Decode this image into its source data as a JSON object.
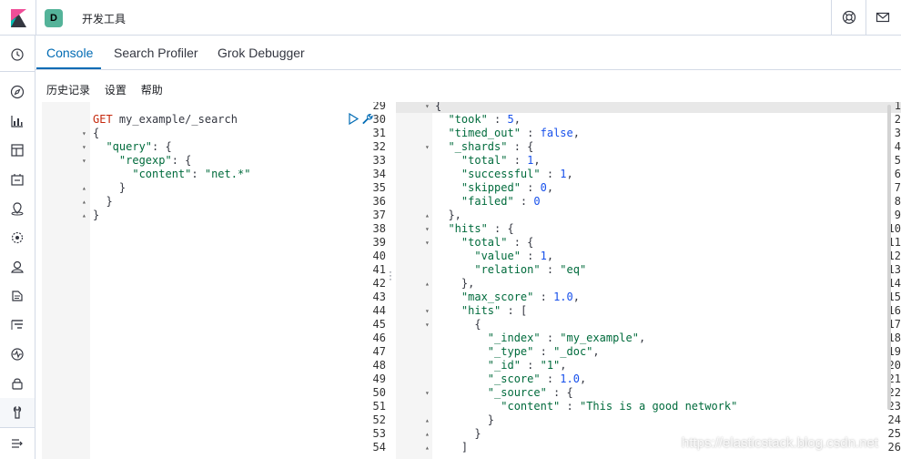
{
  "header": {
    "space_initial": "D",
    "app_title": "开发工具",
    "help_icon": "help-icon",
    "mail_icon": "newsfeed-icon"
  },
  "tabs": [
    {
      "label": "Console",
      "active": true
    },
    {
      "label": "Search Profiler",
      "active": false
    },
    {
      "label": "Grok Debugger",
      "active": false
    }
  ],
  "submenu": {
    "history": "历史记录",
    "settings": "设置",
    "help": "帮助"
  },
  "request_editor": {
    "lines": [
      {
        "n": "29",
        "fold": "",
        "code": ""
      },
      {
        "n": "30",
        "fold": "",
        "code": "GET my_example/_search"
      },
      {
        "n": "31",
        "fold": "▾",
        "code": "{"
      },
      {
        "n": "32",
        "fold": "▾",
        "code": "  \"query\": {"
      },
      {
        "n": "33",
        "fold": "▾",
        "code": "    \"regexp\": {"
      },
      {
        "n": "34",
        "fold": "",
        "code": "      \"content\": \"net.*\""
      },
      {
        "n": "35",
        "fold": "▴",
        "code": "    }"
      },
      {
        "n": "36",
        "fold": "▴",
        "code": "  }"
      },
      {
        "n": "37",
        "fold": "▴",
        "code": "}"
      },
      {
        "n": "38",
        "fold": "",
        "code": ""
      },
      {
        "n": "39",
        "fold": "",
        "code": ""
      },
      {
        "n": "40",
        "fold": "",
        "code": ""
      },
      {
        "n": "41",
        "fold": "",
        "code": ""
      },
      {
        "n": "42",
        "fold": "",
        "code": ""
      },
      {
        "n": "43",
        "fold": "",
        "code": ""
      },
      {
        "n": "44",
        "fold": "",
        "code": ""
      },
      {
        "n": "45",
        "fold": "",
        "code": ""
      },
      {
        "n": "46",
        "fold": "",
        "code": ""
      },
      {
        "n": "47",
        "fold": "",
        "code": ""
      },
      {
        "n": "48",
        "fold": "",
        "code": ""
      },
      {
        "n": "49",
        "fold": "",
        "code": ""
      },
      {
        "n": "50",
        "fold": "",
        "code": ""
      },
      {
        "n": "51",
        "fold": "",
        "code": ""
      },
      {
        "n": "52",
        "fold": "",
        "code": ""
      },
      {
        "n": "53",
        "fold": "",
        "code": ""
      },
      {
        "n": "54",
        "fold": "",
        "code": ""
      }
    ],
    "method": "GET",
    "path": "my_example/_search"
  },
  "response_editor": {
    "lines": [
      {
        "n": "1",
        "fold": "▾",
        "code": "{"
      },
      {
        "n": "2",
        "fold": "",
        "code": "  \"took\" : 5,"
      },
      {
        "n": "3",
        "fold": "",
        "code": "  \"timed_out\" : false,"
      },
      {
        "n": "4",
        "fold": "▾",
        "code": "  \"_shards\" : {"
      },
      {
        "n": "5",
        "fold": "",
        "code": "    \"total\" : 1,"
      },
      {
        "n": "6",
        "fold": "",
        "code": "    \"successful\" : 1,"
      },
      {
        "n": "7",
        "fold": "",
        "code": "    \"skipped\" : 0,"
      },
      {
        "n": "8",
        "fold": "",
        "code": "    \"failed\" : 0"
      },
      {
        "n": "9",
        "fold": "▴",
        "code": "  },"
      },
      {
        "n": "10",
        "fold": "▾",
        "code": "  \"hits\" : {"
      },
      {
        "n": "11",
        "fold": "▾",
        "code": "    \"total\" : {"
      },
      {
        "n": "12",
        "fold": "",
        "code": "      \"value\" : 1,"
      },
      {
        "n": "13",
        "fold": "",
        "code": "      \"relation\" : \"eq\""
      },
      {
        "n": "14",
        "fold": "▴",
        "code": "    },"
      },
      {
        "n": "15",
        "fold": "",
        "code": "    \"max_score\" : 1.0,"
      },
      {
        "n": "16",
        "fold": "▾",
        "code": "    \"hits\" : ["
      },
      {
        "n": "17",
        "fold": "▾",
        "code": "      {"
      },
      {
        "n": "18",
        "fold": "",
        "code": "        \"_index\" : \"my_example\","
      },
      {
        "n": "19",
        "fold": "",
        "code": "        \"_type\" : \"_doc\","
      },
      {
        "n": "20",
        "fold": "",
        "code": "        \"_id\" : \"1\","
      },
      {
        "n": "21",
        "fold": "",
        "code": "        \"_score\" : 1.0,"
      },
      {
        "n": "22",
        "fold": "▾",
        "code": "        \"_source\" : {"
      },
      {
        "n": "23",
        "fold": "",
        "code": "          \"content\" : \"This is a good network\""
      },
      {
        "n": "24",
        "fold": "▴",
        "code": "        }"
      },
      {
        "n": "25",
        "fold": "▴",
        "code": "      }"
      },
      {
        "n": "26",
        "fold": "▴",
        "code": "    ]"
      }
    ]
  },
  "watermark": "https://elasticstack.blog.csdn.net",
  "colors": {
    "accent": "#006bb4",
    "space_avatar": "#54b399",
    "string": "#006b3c",
    "number": "#1750eb",
    "method": "#c5280c"
  },
  "sidenav_icons": [
    "recently-viewed-icon",
    "discover-icon",
    "visualize-icon",
    "dashboard-icon",
    "canvas-icon",
    "maps-icon",
    "ml-icon",
    "metrics-icon",
    "logs-icon",
    "apm-icon",
    "uptime-icon",
    "siem-icon",
    "dev-tools-icon",
    "collapse-nav-icon"
  ]
}
